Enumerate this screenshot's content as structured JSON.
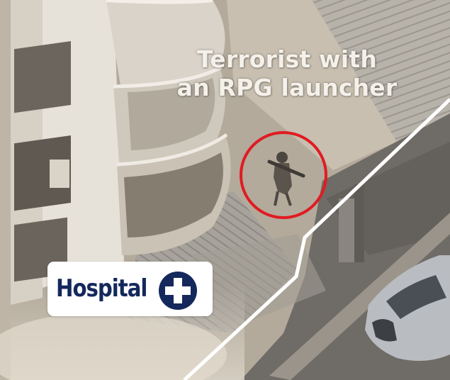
{
  "photo": {
    "caption_lines": [
      "Terrorist with",
      "an RPG launcher"
    ],
    "highlight_color": "#e11b22"
  },
  "label": {
    "text": "Hospital",
    "icon": "medical-cross-icon",
    "text_color": "#14285c",
    "box_color": "#ffffff"
  }
}
